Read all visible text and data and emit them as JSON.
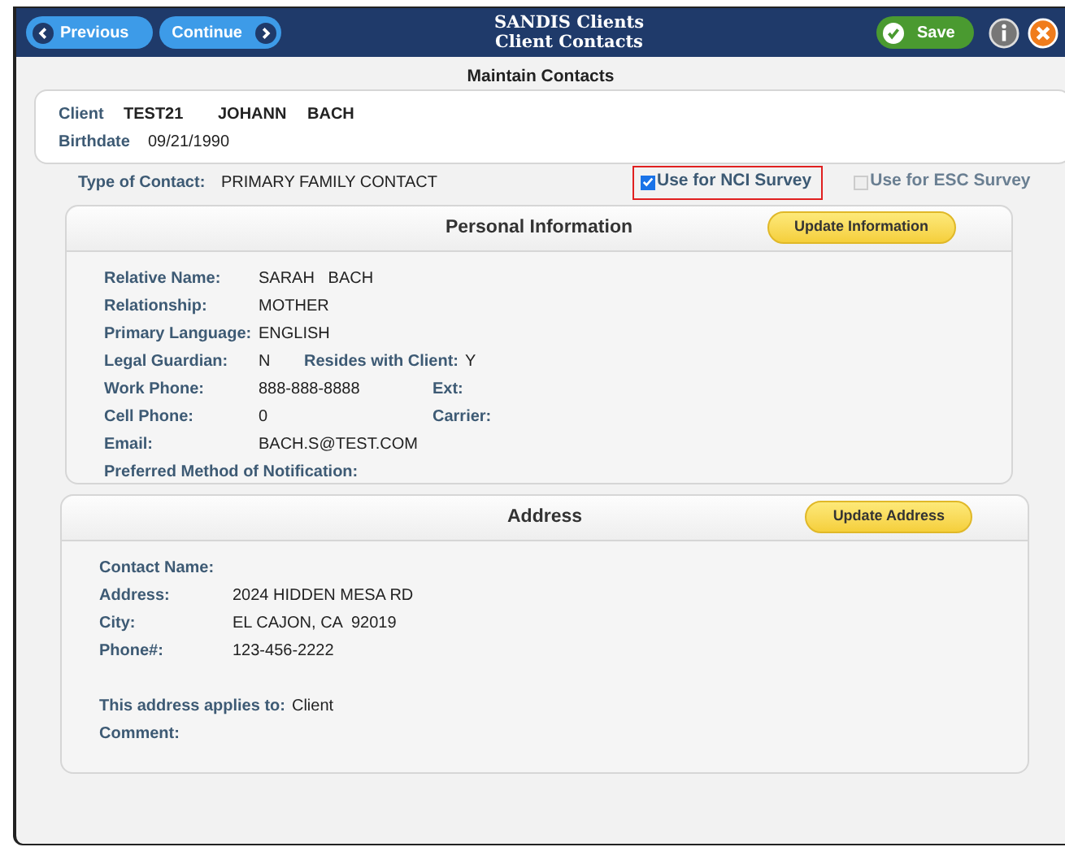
{
  "header": {
    "previous": "Previous",
    "continue": "Continue",
    "title": "SANDIS Clients",
    "subtitle": "Client Contacts",
    "save": "Save"
  },
  "page_title": "Maintain Contacts",
  "client": {
    "label": "Client",
    "id": "TEST21",
    "first_name": "JOHANN",
    "last_name": "BACH",
    "birthdate_label": "Birthdate",
    "birthdate": "09/21/1990"
  },
  "contact_type": {
    "label": "Type of Contact:",
    "value": "PRIMARY FAMILY CONTACT"
  },
  "surveys": [
    {
      "label": "Use for NCI Survey",
      "checked": true,
      "highlighted": true
    },
    {
      "label": "Use for ESC Survey",
      "checked": false,
      "highlighted": false
    }
  ],
  "panels": [
    {
      "title": "Personal Information",
      "button": "Update Information",
      "rows": [
        [
          {
            "label": "Relative Name:",
            "value": "SARAH   BACH"
          }
        ],
        [
          {
            "label": "Relationship:",
            "value": "MOTHER"
          }
        ],
        [
          {
            "label": "Primary Language:",
            "value": "ENGLISH"
          }
        ],
        [
          {
            "label": "Legal Guardian:",
            "value": "N"
          },
          {
            "label": "Resides with Client:",
            "value": "Y"
          }
        ],
        [
          {
            "label": "Work Phone:",
            "value": "888-888-8888"
          },
          {
            "label": "Ext:"
          }
        ],
        [
          {
            "label": "Cell Phone:",
            "value": "0"
          },
          {
            "label": "Carrier:"
          }
        ],
        [
          {
            "label": "Email:",
            "value": "BACH.S@TEST.COM"
          }
        ],
        [
          {
            "label": "Preferred Method of Notification:"
          }
        ]
      ]
    },
    {
      "title": "Address",
      "button": "Update Address",
      "rows": [
        [
          {
            "label": "Contact Name:"
          }
        ],
        [
          {
            "label": "Address:",
            "value": "2024 HIDDEN MESA RD"
          }
        ],
        [
          {
            "label": "City:",
            "value": "EL CAJON, CA  92019"
          }
        ],
        [
          {
            "label": "Phone#:",
            "value": "123-456-2222"
          }
        ],
        [],
        [
          {
            "label": "This address applies to:",
            "value": "Client"
          }
        ],
        [
          {
            "label": "Comment:"
          }
        ]
      ]
    }
  ]
}
